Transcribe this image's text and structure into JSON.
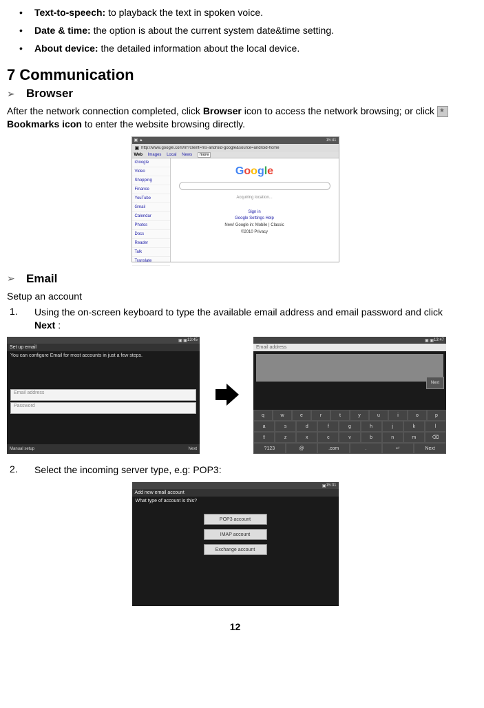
{
  "settings_list": [
    {
      "term": "Text-to-speech:",
      "desc": " to playback the text in spoken voice."
    },
    {
      "term": "Date & time:",
      "desc": " the option is about the current system date&time setting."
    },
    {
      "term": "About device:",
      "desc": " the detailed information about the local device."
    }
  ],
  "section7": {
    "heading": "7 Communication",
    "browser": {
      "title": "Browser",
      "para_a": "After the network connection completed, click ",
      "para_b": "Browser",
      "para_c": " icon to access the network browsing; or click ",
      "para_d": " Bookmarks icon",
      "para_e": " to enter the website browsing directly."
    },
    "email": {
      "title": "Email",
      "setup_line": "Setup an account",
      "step1_a": "Using the on-screen keyboard to type the available email address and email password and click ",
      "step1_b": "Next",
      "step1_c": " :",
      "step2": "Select the incoming server type, e.g: POP3:"
    }
  },
  "browser_shot": {
    "time": "15:41",
    "url": "http://www.google.com/m?client=ms-android-google&source=android-home",
    "tabs": [
      "Web",
      "Images",
      "Local",
      "News",
      "more"
    ],
    "menu": [
      "iGoogle",
      "Video",
      "Shopping",
      "Finance",
      "YouTube",
      "Gmail",
      "Calendar",
      "Photos",
      "Docs",
      "Reader",
      "Talk",
      "Translate"
    ],
    "loading": "Acquiring location...",
    "links": [
      "Sign in",
      "Google  Settings  Help",
      "New! Google in: Mobile | Classic",
      "©2010  Privacy"
    ]
  },
  "email_shot1": {
    "time": "13:45",
    "title": "Set up email",
    "hint": "You can configure Email for most accounts in just a few steps.",
    "placeholder1": "Email address",
    "placeholder2": "Password",
    "manual": "Manual setup",
    "next": "Next"
  },
  "email_shot2": {
    "time": "13:47",
    "addr": "Email address",
    "next": "Next",
    "kbd_rows": [
      [
        "q",
        "w",
        "e",
        "r",
        "t",
        "y",
        "u",
        "i",
        "o",
        "p"
      ],
      [
        "a",
        "s",
        "d",
        "f",
        "g",
        "h",
        "j",
        "k",
        "l"
      ],
      [
        "⇧",
        "z",
        "x",
        "c",
        "v",
        "b",
        "n",
        "m",
        "⌫"
      ],
      [
        "?123",
        "@",
        ".com",
        ".",
        "↵",
        "Next"
      ]
    ]
  },
  "server_shot": {
    "time": "15:31",
    "title": "Add new email account",
    "question": "What type of account is this?",
    "btn1": "POP3 account",
    "btn2": "IMAP account",
    "btn3": "Exchange account"
  },
  "page_number": "12"
}
